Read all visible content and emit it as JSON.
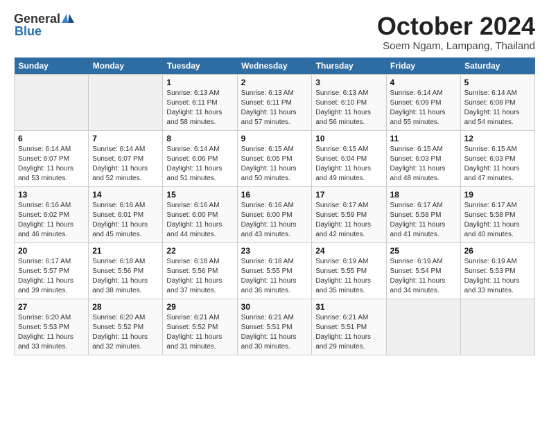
{
  "logo": {
    "general": "General",
    "blue": "Blue"
  },
  "title": "October 2024",
  "subtitle": "Soem Ngam, Lampang, Thailand",
  "headers": [
    "Sunday",
    "Monday",
    "Tuesday",
    "Wednesday",
    "Thursday",
    "Friday",
    "Saturday"
  ],
  "weeks": [
    [
      {
        "day": "",
        "info": ""
      },
      {
        "day": "",
        "info": ""
      },
      {
        "day": "1",
        "info": "Sunrise: 6:13 AM\nSunset: 6:11 PM\nDaylight: 11 hours\nand 58 minutes."
      },
      {
        "day": "2",
        "info": "Sunrise: 6:13 AM\nSunset: 6:11 PM\nDaylight: 11 hours\nand 57 minutes."
      },
      {
        "day": "3",
        "info": "Sunrise: 6:13 AM\nSunset: 6:10 PM\nDaylight: 11 hours\nand 56 minutes."
      },
      {
        "day": "4",
        "info": "Sunrise: 6:14 AM\nSunset: 6:09 PM\nDaylight: 11 hours\nand 55 minutes."
      },
      {
        "day": "5",
        "info": "Sunrise: 6:14 AM\nSunset: 6:08 PM\nDaylight: 11 hours\nand 54 minutes."
      }
    ],
    [
      {
        "day": "6",
        "info": "Sunrise: 6:14 AM\nSunset: 6:07 PM\nDaylight: 11 hours\nand 53 minutes."
      },
      {
        "day": "7",
        "info": "Sunrise: 6:14 AM\nSunset: 6:07 PM\nDaylight: 11 hours\nand 52 minutes."
      },
      {
        "day": "8",
        "info": "Sunrise: 6:14 AM\nSunset: 6:06 PM\nDaylight: 11 hours\nand 51 minutes."
      },
      {
        "day": "9",
        "info": "Sunrise: 6:15 AM\nSunset: 6:05 PM\nDaylight: 11 hours\nand 50 minutes."
      },
      {
        "day": "10",
        "info": "Sunrise: 6:15 AM\nSunset: 6:04 PM\nDaylight: 11 hours\nand 49 minutes."
      },
      {
        "day": "11",
        "info": "Sunrise: 6:15 AM\nSunset: 6:03 PM\nDaylight: 11 hours\nand 48 minutes."
      },
      {
        "day": "12",
        "info": "Sunrise: 6:15 AM\nSunset: 6:03 PM\nDaylight: 11 hours\nand 47 minutes."
      }
    ],
    [
      {
        "day": "13",
        "info": "Sunrise: 6:16 AM\nSunset: 6:02 PM\nDaylight: 11 hours\nand 46 minutes."
      },
      {
        "day": "14",
        "info": "Sunrise: 6:16 AM\nSunset: 6:01 PM\nDaylight: 11 hours\nand 45 minutes."
      },
      {
        "day": "15",
        "info": "Sunrise: 6:16 AM\nSunset: 6:00 PM\nDaylight: 11 hours\nand 44 minutes."
      },
      {
        "day": "16",
        "info": "Sunrise: 6:16 AM\nSunset: 6:00 PM\nDaylight: 11 hours\nand 43 minutes."
      },
      {
        "day": "17",
        "info": "Sunrise: 6:17 AM\nSunset: 5:59 PM\nDaylight: 11 hours\nand 42 minutes."
      },
      {
        "day": "18",
        "info": "Sunrise: 6:17 AM\nSunset: 5:58 PM\nDaylight: 11 hours\nand 41 minutes."
      },
      {
        "day": "19",
        "info": "Sunrise: 6:17 AM\nSunset: 5:58 PM\nDaylight: 11 hours\nand 40 minutes."
      }
    ],
    [
      {
        "day": "20",
        "info": "Sunrise: 6:17 AM\nSunset: 5:57 PM\nDaylight: 11 hours\nand 39 minutes."
      },
      {
        "day": "21",
        "info": "Sunrise: 6:18 AM\nSunset: 5:56 PM\nDaylight: 11 hours\nand 38 minutes."
      },
      {
        "day": "22",
        "info": "Sunrise: 6:18 AM\nSunset: 5:56 PM\nDaylight: 11 hours\nand 37 minutes."
      },
      {
        "day": "23",
        "info": "Sunrise: 6:18 AM\nSunset: 5:55 PM\nDaylight: 11 hours\nand 36 minutes."
      },
      {
        "day": "24",
        "info": "Sunrise: 6:19 AM\nSunset: 5:55 PM\nDaylight: 11 hours\nand 35 minutes."
      },
      {
        "day": "25",
        "info": "Sunrise: 6:19 AM\nSunset: 5:54 PM\nDaylight: 11 hours\nand 34 minutes."
      },
      {
        "day": "26",
        "info": "Sunrise: 6:19 AM\nSunset: 5:53 PM\nDaylight: 11 hours\nand 33 minutes."
      }
    ],
    [
      {
        "day": "27",
        "info": "Sunrise: 6:20 AM\nSunset: 5:53 PM\nDaylight: 11 hours\nand 33 minutes."
      },
      {
        "day": "28",
        "info": "Sunrise: 6:20 AM\nSunset: 5:52 PM\nDaylight: 11 hours\nand 32 minutes."
      },
      {
        "day": "29",
        "info": "Sunrise: 6:21 AM\nSunset: 5:52 PM\nDaylight: 11 hours\nand 31 minutes."
      },
      {
        "day": "30",
        "info": "Sunrise: 6:21 AM\nSunset: 5:51 PM\nDaylight: 11 hours\nand 30 minutes."
      },
      {
        "day": "31",
        "info": "Sunrise: 6:21 AM\nSunset: 5:51 PM\nDaylight: 11 hours\nand 29 minutes."
      },
      {
        "day": "",
        "info": ""
      },
      {
        "day": "",
        "info": ""
      }
    ]
  ]
}
